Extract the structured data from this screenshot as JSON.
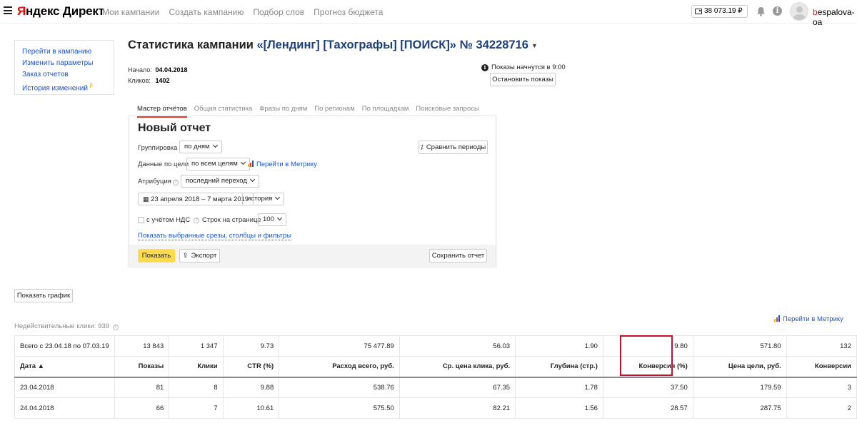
{
  "header": {
    "logo_y": "Я",
    "logo_rest": "ндекс Директ",
    "nav": [
      "Мои кампании",
      "Создать кампанию",
      "Подбор слов",
      "Прогноз бюджета"
    ],
    "balance": "38 073.19 ₽",
    "username_first": "b",
    "username_rest": "espalova-oa"
  },
  "sidebar": {
    "items": [
      "Перейти в кампанию",
      "Изменить параметры",
      "Заказ отчетов",
      "История изменений"
    ],
    "history_badge": "β"
  },
  "campaign": {
    "title_prefix": "Статистика кампании ",
    "title_name": "«[Лендинг] [Тахографы] [ПОИСК]» № 34228716",
    "start_label": "Начало:",
    "start_value": "04.04.2018",
    "clicks_label": "Кликов:",
    "clicks_value": "1402",
    "notice": "Показы начнутся в 9:00",
    "stop_button": "Остановить показы"
  },
  "tabs": [
    "Мастер отчётов",
    "Общая статистика",
    "Фразы по дням",
    "По регионам",
    "По площадкам",
    "Поисковые запросы"
  ],
  "report": {
    "title": "Новый отчет",
    "grouping_label": "Группировка",
    "grouping_value": "по дням",
    "compare_button": "Сравнить периоды",
    "goal_label": "Данные по цели",
    "goal_value": "по всем целям",
    "metrika_link": "Перейти в Метрику",
    "attribution_label": "Атрибуция",
    "attribution_value": "последний переход",
    "date_range": "23 апреля 2018 – 7 марта 2019",
    "history_value": "история",
    "vat_label": "с учётом НДС",
    "rows_label": "Строк на странице",
    "rows_value": "100",
    "slices_link": "Показать выбранные срезы, столбцы и фильтры",
    "show_button": "Показать",
    "export_button": "Экспорт",
    "save_button": "Сохранить отчет"
  },
  "graph_button": "Показать график",
  "invalid_clicks": "Недействительные клики: 939",
  "metrika_link2": "Перейти в Метрику",
  "table": {
    "total_row": [
      "Всего с 23.04.18 по 07.03.19",
      "13 843",
      "1 347",
      "9.73",
      "75 477.89",
      "56.03",
      "1.90",
      "9.80",
      "571.80",
      "132"
    ],
    "headers": [
      "Дата ▲",
      "Показы",
      "Клики",
      "CTR (%)",
      "Расход всего, руб.",
      "Ср. цена клика, руб.",
      "Глубина (стр.)",
      "Конверсия (%)",
      "Цена цели, руб.",
      "Конверсии"
    ],
    "rows": [
      [
        "23.04.2018",
        "81",
        "8",
        "9.88",
        "538.76",
        "67.35",
        "1.78",
        "37.50",
        "179.59",
        "3"
      ],
      [
        "24.04.2018",
        "66",
        "7",
        "10.61",
        "575.50",
        "82.21",
        "1.56",
        "28.57",
        "287.75",
        "2"
      ]
    ]
  },
  "colors": {
    "accent_link": "#1f53c6",
    "highlight": "#c8102e",
    "action": "#ffdb4d",
    "tab_underline": "#e23b2e"
  }
}
